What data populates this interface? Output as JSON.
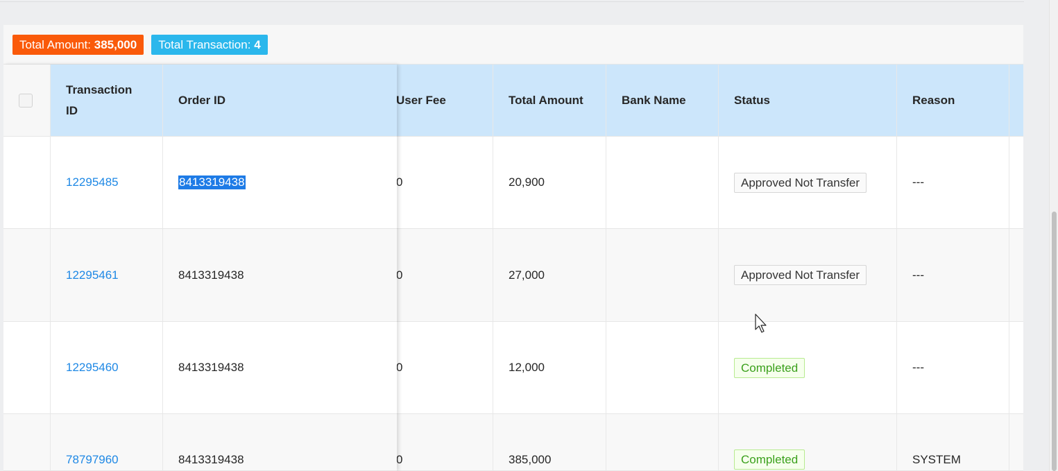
{
  "summary": {
    "total_amount_label": "Total Amount:",
    "total_amount_value": "385,000",
    "total_transaction_label": "Total Transaction:",
    "total_transaction_value": "4",
    "colors": {
      "amount_badge": "#fa5a0a",
      "transaction_badge": "#2bb7ec",
      "header_bg": "#cce6fb",
      "link": "#1e88e5"
    }
  },
  "table": {
    "headers": {
      "transaction_id": "Transaction ID",
      "order_id": "Order ID",
      "user_fee": "User Fee",
      "total_amount": "Total Amount",
      "bank_name": "Bank Name",
      "status": "Status",
      "reason": "Reason"
    },
    "rows": [
      {
        "transaction_id": "12295485",
        "order_id": "8413319438",
        "user_fee": "0",
        "total_amount": "20,900",
        "bank_name": "",
        "status": "Approved Not Transfer",
        "reason": "---"
      },
      {
        "transaction_id": "12295461",
        "order_id": "8413319438",
        "user_fee": "0",
        "total_amount": "27,000",
        "bank_name": "",
        "status": "Approved Not Transfer",
        "reason": "---"
      },
      {
        "transaction_id": "12295460",
        "order_id": "8413319438",
        "user_fee": "0",
        "total_amount": "12,000",
        "bank_name": "",
        "status": "Completed",
        "reason": "---"
      },
      {
        "transaction_id": "78797960",
        "order_id": "8413319438",
        "user_fee": "0",
        "total_amount": "385,000",
        "bank_name": "",
        "status": "Completed",
        "reason": "SYSTEM"
      }
    ]
  }
}
